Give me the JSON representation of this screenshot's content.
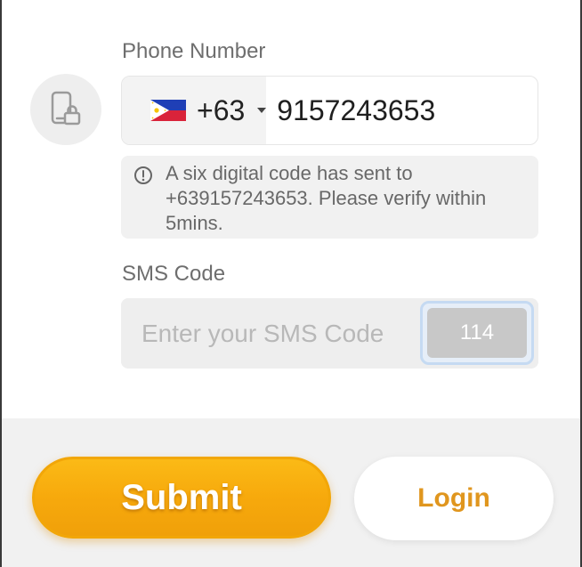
{
  "phone": {
    "label": "Phone Number",
    "country_code": "+63",
    "flag": "philippines-flag",
    "number": "9157243653"
  },
  "notice": {
    "icon": "info-icon",
    "text": "A six digital code has sent to +639157243653. Please verify within 5mins."
  },
  "sms": {
    "label": "SMS Code",
    "placeholder": "Enter your SMS Code",
    "countdown": "114"
  },
  "actions": {
    "submit_label": "Submit",
    "login_label": "Login"
  },
  "colors": {
    "accent": "#f7a90c",
    "login_text": "#e0961e"
  }
}
